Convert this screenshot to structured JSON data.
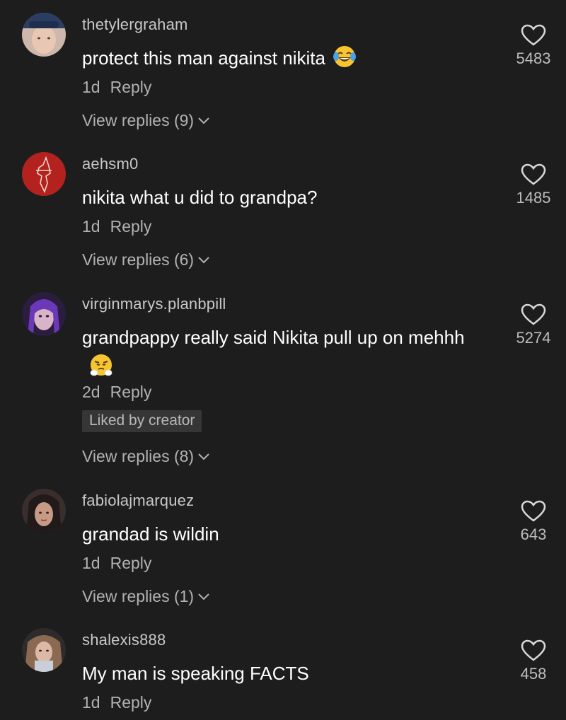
{
  "comments": [
    {
      "username": "thetylergraham",
      "text": "protect this man against nikita",
      "emoji_icon": "face-with-tears-of-joy-icon",
      "age": "1d",
      "reply_label": "Reply",
      "view_replies": "View replies (9)",
      "likes": "5483"
    },
    {
      "username": "aehsm0",
      "text": "nikita what u did to grandpa?",
      "age": "1d",
      "reply_label": "Reply",
      "view_replies": "View replies (6)",
      "likes": "1485"
    },
    {
      "username": "virginmarys.planbpill",
      "text": "grandpappy really said Nikita pull up on mehhh",
      "emoji_icon": "face-with-steam-from-nose-icon",
      "age": "2d",
      "reply_label": "Reply",
      "liked_badge": "Liked by creator",
      "view_replies": "View replies (8)",
      "likes": "5274"
    },
    {
      "username": "fabiolajmarquez",
      "text": "grandad is wildin",
      "age": "1d",
      "reply_label": "Reply",
      "view_replies": "View replies (1)",
      "likes": "643"
    },
    {
      "username": "shalexis888",
      "text": "My man is speaking FACTS",
      "age": "1d",
      "reply_label": "Reply",
      "likes": "458"
    }
  ],
  "colors": {
    "background": "#1d1d1d",
    "username": "#c8c8c8",
    "comment_text": "#ffffff",
    "meta_text": "#b2b2b2",
    "badge_bg": "#363636"
  }
}
